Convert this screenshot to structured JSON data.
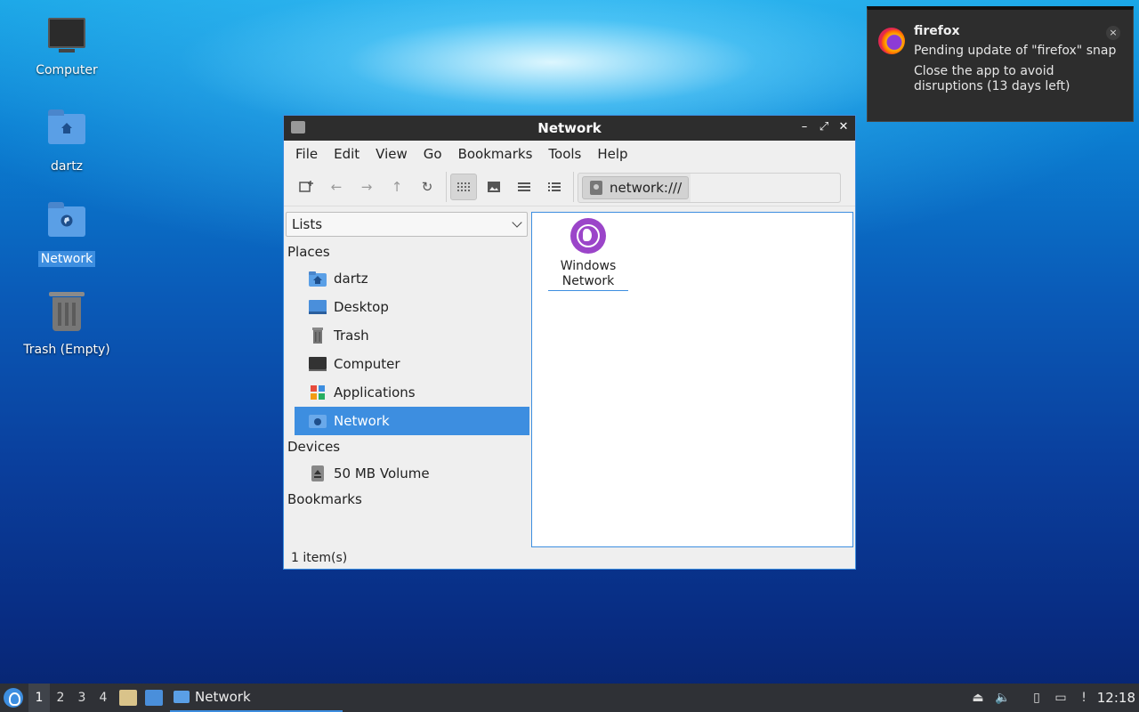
{
  "desktop": {
    "icons": [
      {
        "label": "Computer"
      },
      {
        "label": "dartz"
      },
      {
        "label": "Network"
      },
      {
        "label": "Trash (Empty)"
      }
    ]
  },
  "notification": {
    "app": "firefox",
    "line1": "Pending update of \"firefox\" snap",
    "line2": "Close the app to avoid disruptions (13 days left)",
    "close": "×"
  },
  "window": {
    "title": "Network",
    "controls": {
      "minimize": "–",
      "maximize": "⤢",
      "close": "✕"
    },
    "menu": [
      "File",
      "Edit",
      "View",
      "Go",
      "Bookmarks",
      "Tools",
      "Help"
    ],
    "location": "network:///",
    "sidebar": {
      "mode": "Lists",
      "places_title": "Places",
      "places": [
        "dartz",
        "Desktop",
        "Trash",
        "Computer",
        "Applications",
        "Network"
      ],
      "devices_title": "Devices",
      "devices": [
        "50 MB Volume"
      ],
      "bookmarks_title": "Bookmarks"
    },
    "content": {
      "items": [
        {
          "label": "Windows Network"
        }
      ]
    },
    "status": "1 item(s)"
  },
  "taskbar": {
    "workspaces": [
      "1",
      "2",
      "3",
      "4"
    ],
    "task": "Network",
    "clock": "12:18"
  },
  "colors": {
    "accent": "#3d8ee0",
    "titlebar": "#2d2d2d",
    "taskbar": "#2f3136"
  }
}
